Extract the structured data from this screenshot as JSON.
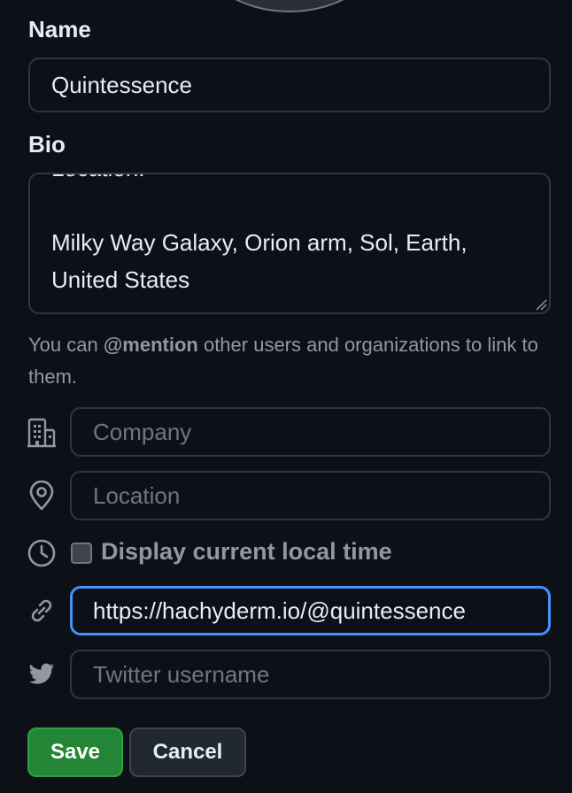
{
  "profile": {
    "name_label": "Name",
    "name_value": "Quintessence",
    "bio_label": "Bio",
    "bio_lines": {
      "cut_off": "Location:",
      "line1": "Milky Way Galaxy, Orion arm, Sol, Earth,",
      "line2": "United States"
    },
    "hint_prefix": "You can ",
    "hint_mention": "@mention",
    "hint_suffix": " other users and organizations to link to them.",
    "company_placeholder": "Company",
    "location_placeholder": "Location",
    "local_time_label": "Display current local time",
    "local_time_checked": false,
    "website_value": "https://hachyderm.io/@quintessence",
    "twitter_placeholder": "Twitter username"
  },
  "buttons": {
    "save": "Save",
    "cancel": "Cancel"
  },
  "icons": {
    "company": "organization-icon",
    "location": "location-pin-icon",
    "time": "clock-icon",
    "website": "link-icon",
    "twitter": "twitter-icon"
  },
  "colors": {
    "background": "#0d1117",
    "accent_focus": "#4493f8",
    "save_button": "#238636"
  }
}
